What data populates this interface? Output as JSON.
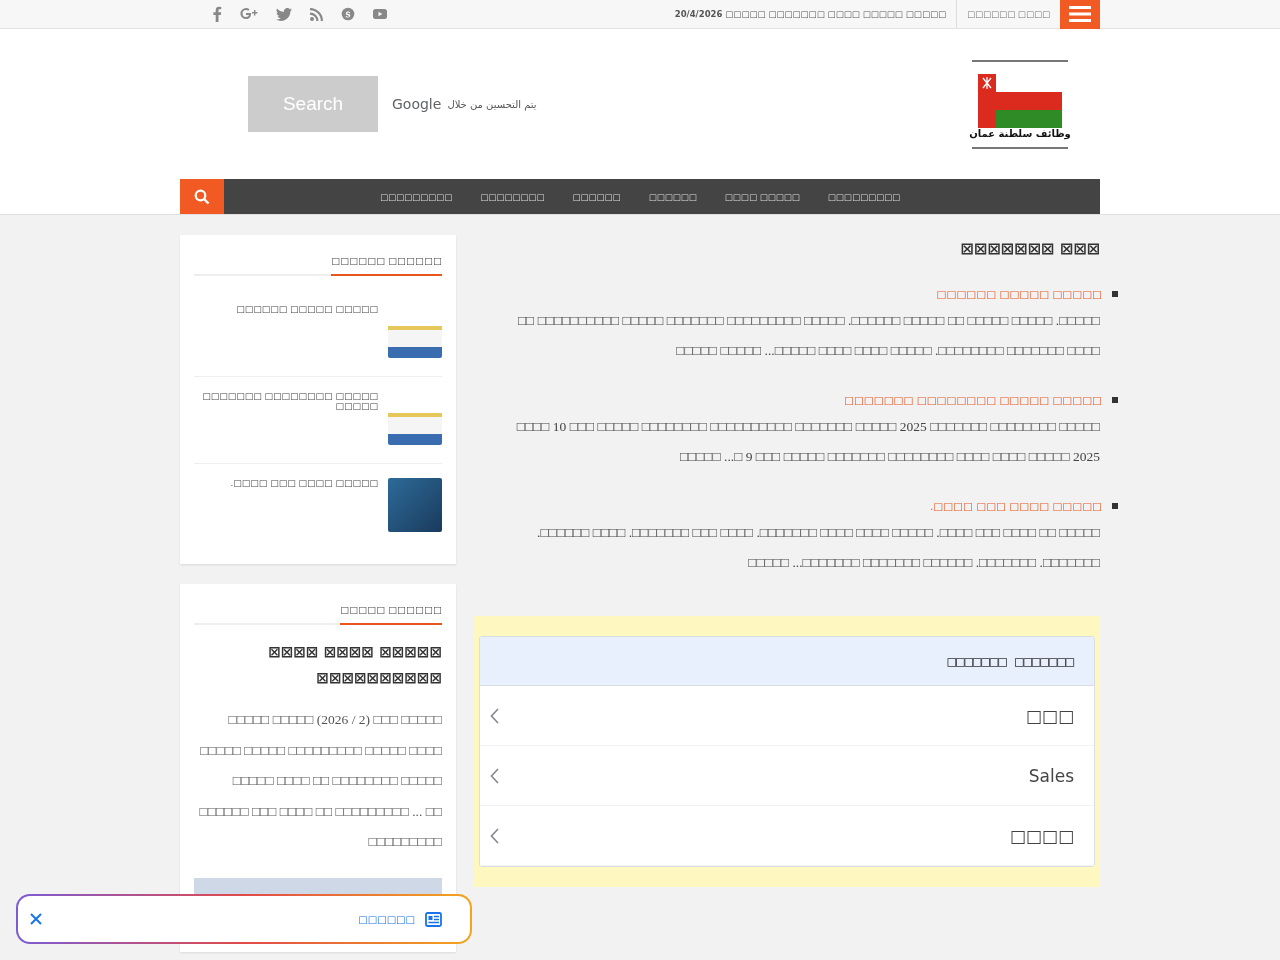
{
  "topbar": {
    "date_line": "20/4/2026 □□□□□ □□□□□□□ □□□□ □□□□□ □□□□□",
    "menu_label": "□□□□□□ □□□□"
  },
  "header": {
    "search_button": "Search",
    "google_brand": "Google",
    "powered_by": "يتم التحسين من خلال",
    "logo_text": "وظائف سلطنة عمان"
  },
  "nav": {
    "items": [
      {
        "label": "□□□□□□□□□"
      },
      {
        "label": "□□□□□□□□"
      },
      {
        "label": "□□□□□□"
      },
      {
        "label": "□□□□□□"
      },
      {
        "label": "□□□□ □□□□□"
      },
      {
        "label": "□□□□□□□□□"
      }
    ]
  },
  "main": {
    "title": "⊠⊠⊠⊠⊠⊠⊠ ⊠⊠⊠",
    "posts": [
      {
        "title": "□□□□□□ □□□□□ □□□□□",
        "excerpt": "□□ □□□□□□□□□□ □□□□□ □□□□□□□ □□□□□□□□□ □□□□□ .□□□□□□ □□□□□ □□ □□□□□ □□□□□ .□□□□□ □□□□□ □□□□□ ...□□□□□ □□□□ □□□□ □□□□□ .□□□□□□□□ □□□□□□□ □□□□"
      },
      {
        "title": "□□□□□□□ □□□□□□□□ □□□□□ □□□□□",
        "excerpt": "□□□□ 10 □□□ □□□□□  □□□□□□□□ □□□□□□□□□□ □□□□□□□ □□□□□ 2025 □□□□□□□ □□□□□□□□ □□□□□ □□□□□ ...□ 9 □□□ □□□□□  □□□□□□□ □□□□□□□□ □□□□ □□□□ □□□□□ 2025"
      },
      {
        "title": ".□□□□ □□□ □□□□ □□□□□",
        "excerpt": ".□□□□□□ □□□□ .□□□□□□□ □□□ □□□□ .□□□□□□□ □□□□ □□□□ □□□□□ .□□□□ □□□ □□□□ □□ □□□□□ □□□□□ ...□□□□□□□ □□□□□□□ □□□□□□ .□□□□□□□ .□□□□□□□"
      }
    ],
    "accordion": {
      "title": "□□□□□□□ □□□□□□□",
      "rows": [
        {
          "label": "□□□"
        },
        {
          "label": "Sales"
        },
        {
          "label": "□□□□"
        }
      ]
    }
  },
  "sidebar": {
    "recent": {
      "heading": "□□□□□□ □□□□□□",
      "items": [
        {
          "title": "□□□□□□ □□□□□ □□□□□",
          "kind": "document"
        },
        {
          "title": "□□□□□□□ □□□□□□□□ □□□□□ □□□□□",
          "kind": "document"
        },
        {
          "title": ".□□□□ □□□ □□□□ □□□□□",
          "kind": "photo"
        }
      ]
    },
    "featured": {
      "heading": "□□□□□ □□□□□□",
      "title": "⊠⊠⊠⊠ ⊠⊠⊠⊠ ⊠⊠⊠⊠⊠ ⊠⊠⊠⊠⊠⊠⊠⊠⊠⊠",
      "excerpt": "□□□□□ □□□□□ (2026 / 2) □□□ □□□□□ □□□□□ □□□□□ □□□□□□□□□ □□□□□ □□□□ □□□□□ □□□□ □□ □□□□□□□□ □□□□□ □□□□□□ □□□ □□□□ □□ □□□□□□□□□ ... □□ □□□□□□□□□"
    }
  },
  "floating_bar": {
    "label": "□□□□□□"
  }
}
